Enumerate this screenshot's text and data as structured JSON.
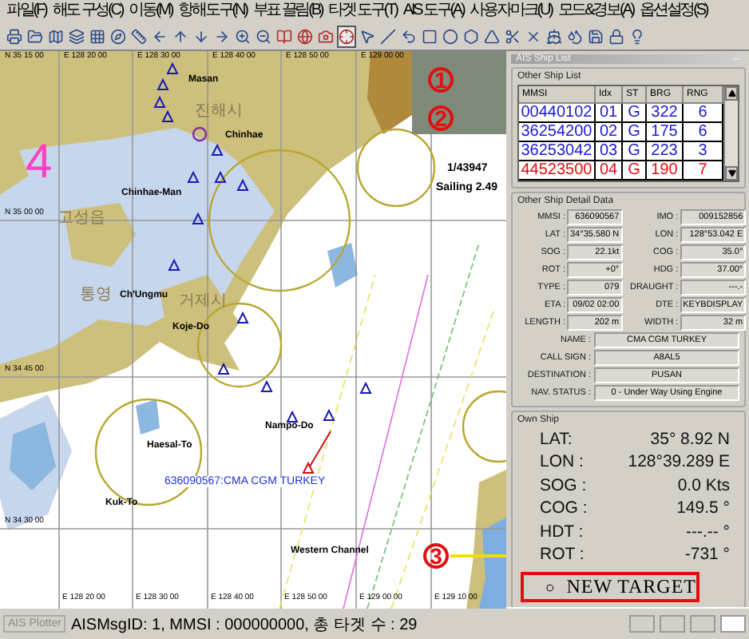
{
  "menu": [
    "파일(F)",
    "해도 구성(C)",
    "이동(M)",
    "항해도구(N)",
    "부표 끌림(B)",
    "타겟 도구(T)",
    "AIS 도구(A)",
    "사용자마크(U)",
    "모드&경보(A)",
    "옵션설정(S)"
  ],
  "chart": {
    "lon_labels_top": [
      "E 128 20 00",
      "E 128 30 00",
      "E 128 40 00",
      "E 128 50 00",
      "E 129 00 00"
    ],
    "lon_labels_bottom": [
      "E 128 20 00",
      "E 128 30 00",
      "E 128 40 00",
      "E 128 50 00",
      "E 129 00 00",
      "E 129 10 00"
    ],
    "lat_labels": [
      "N 35 15 00",
      "N 35 00 00",
      "N 34 45 00",
      "N 34 30 00"
    ],
    "places": [
      {
        "text": "Masan",
        "kind": "en"
      },
      {
        "text": "진해시",
        "kind": "ko"
      },
      {
        "text": "Chinhae",
        "kind": "en"
      },
      {
        "text": "Chinhae-Man",
        "kind": "en"
      },
      {
        "text": "고성읍",
        "kind": "ko"
      },
      {
        "text": "통영",
        "kind": "ko"
      },
      {
        "text": "Ch'Ungmu",
        "kind": "en"
      },
      {
        "text": "거제시",
        "kind": "ko"
      },
      {
        "text": "Koje-Do",
        "kind": "en"
      },
      {
        "text": "Kuk-To",
        "kind": "en"
      },
      {
        "text": "Nampo-Do",
        "kind": "en"
      },
      {
        "text": "Haesal-To",
        "kind": "en"
      },
      {
        "text": "Western Channel",
        "kind": "en"
      }
    ],
    "sector_number": "4",
    "target_label": "636090567:CMA CGM TURKEY",
    "scale": "1/43947",
    "mode": "Sailing 2.49",
    "callouts": [
      "1",
      "2",
      "3"
    ]
  },
  "ship_panel": {
    "title": "AIS Ship List",
    "list_title": "Other Ship List",
    "columns": [
      "MMSI",
      "Idx",
      "ST",
      "BRG",
      "RNG"
    ],
    "rows": [
      {
        "cells": [
          "00440102",
          "01",
          "G",
          "322",
          "6"
        ],
        "selected": false
      },
      {
        "cells": [
          "36254200",
          "02",
          "G",
          "175",
          "6"
        ],
        "selected": false
      },
      {
        "cells": [
          "36253042",
          "03",
          "G",
          "223",
          "3"
        ],
        "selected": false
      },
      {
        "cells": [
          "44523500",
          "04",
          "G",
          "190",
          "7"
        ],
        "selected": true
      }
    ],
    "detail_title": "Other Ship Detail Data",
    "detail_pairs": [
      {
        "label": "MMSI :",
        "value": "636090567"
      },
      {
        "label": "IMO :",
        "value": "009152856"
      },
      {
        "label": "LAT :",
        "value": "34°35.580 N"
      },
      {
        "label": "LON :",
        "value": "128°53.042 E"
      },
      {
        "label": "SOG :",
        "value": "22.1kt"
      },
      {
        "label": "COG :",
        "value": "35.0°"
      },
      {
        "label": "ROT :",
        "value": "+0°"
      },
      {
        "label": "HDG :",
        "value": "37.00°"
      },
      {
        "label": "TYPE :",
        "value": "079"
      },
      {
        "label": "DRAUGHT :",
        "value": "---.-"
      },
      {
        "label": "ETA :",
        "value": "09/02 02:00"
      },
      {
        "label": "DTE :",
        "value": "KEYBDISPLAY"
      },
      {
        "label": "LENGTH :",
        "value": "202 m"
      },
      {
        "label": "WIDTH :",
        "value": "32 m"
      }
    ],
    "detail_wide": [
      {
        "label": "NAME :",
        "value": "CMA CGM TURKEY"
      },
      {
        "label": "CALL SIGN :",
        "value": "A8AL5"
      },
      {
        "label": "DESTINATION :",
        "value": "PUSAN"
      },
      {
        "label": "NAV. STATUS :",
        "value": "0 - Under Way Using Engine"
      }
    ],
    "own_title": "Own Ship",
    "own": [
      {
        "label": "LAT:",
        "value": "35° 8.92  N"
      },
      {
        "label": "LON :",
        "value": "128°39.289 E"
      },
      {
        "label": "SOG :",
        "value": "0.0 Kts"
      },
      {
        "label": "COG :",
        "value": "149.5 °"
      },
      {
        "label": "HDT :",
        "value": "---.-- °"
      },
      {
        "label": "ROT :",
        "value": "-731 °"
      }
    ],
    "alert": "NEW TARGET"
  },
  "status": {
    "tab": "AIS Plotter",
    "message": "AISMsgID: 1, MMSI : 000000000, 총 타겟 수 : 29"
  }
}
